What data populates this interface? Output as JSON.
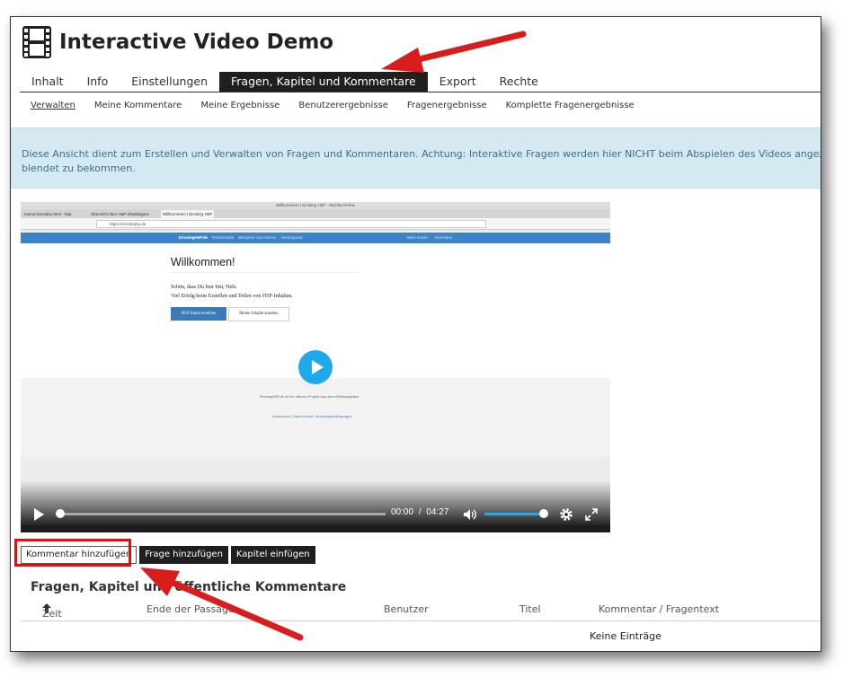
{
  "app": {
    "title": "Interactive Video Demo"
  },
  "tabs": [
    "Inhalt",
    "Info",
    "Einstellungen",
    "Fragen, Kapitel und Kommentare",
    "Export",
    "Rechte"
  ],
  "subtabs": [
    "Verwalten",
    "Meine Kommentare",
    "Meine Ergebnisse",
    "Benutzerergebnisse",
    "Fragenergebnisse",
    "Komplette Fragenergebnisse"
  ],
  "info": {
    "line1": "Diese Ansicht dient zum Erstellen und Verwalten von Fragen und Kommentaren. Achtung: Interaktive Fragen werden hier NICHT beim Abspielen des Videos angezeigt, wech",
    "line2": "blendet zu bekommen."
  },
  "video": {
    "browser_title": "Willkommen! | Einstieg H5P - Mozilla Firefox",
    "browser_tabs": [
      "interactivevideo.html - h5p",
      "Übersicht über H5P-Inhaltstypen",
      "Willkommen! | Einstieg H5P"
    ],
    "url": "https://einstieghp.de",
    "site_nav": [
      "EinstiegH5P.de",
      "Tests/Inhalte",
      "Beispiele zum Remix",
      "Hintergrund",
      "Mein Konto",
      "Abmelden"
    ],
    "welcome": "Willkommen!",
    "para1": "Schön, dass Du hier bist, Nele.",
    "para2": "Viel Erfolg beim Erstellen und Teilen von H5P-Inhalten.",
    "btn_create": "H5P-Inhalt erstellen",
    "btn_view": "Meine Inhalte ansehen",
    "footer1": "EinstiegH5P.de ist ein offenes Projekt aus dem eBildungslabor",
    "footer2": "Impressum | Datenschutz | Nutzungsbedingungen",
    "current_time": "00:00",
    "separator": "/",
    "duration": "04:27",
    "volume_level": 0.92
  },
  "actions": {
    "add_comment": "Kommentar hinzufügen",
    "add_question": "Frage hinzufügen",
    "add_chapter": "Kapitel einfügen"
  },
  "section": {
    "heading": "Fragen, Kapitel und öffentliche Kommentare"
  },
  "table": {
    "headers": [
      "Zeit",
      "Ende der Passage",
      "Benutzer",
      "Titel",
      "Kommentar / Fragentext"
    ],
    "sort_icon": "arrow-up-icon",
    "empty": "Keine Einträge"
  },
  "colors": {
    "accent": "#1fa9ec",
    "tab_active": "#1f1f1f",
    "info_bg": "#d5e9f2",
    "annotation": "#e01010"
  }
}
